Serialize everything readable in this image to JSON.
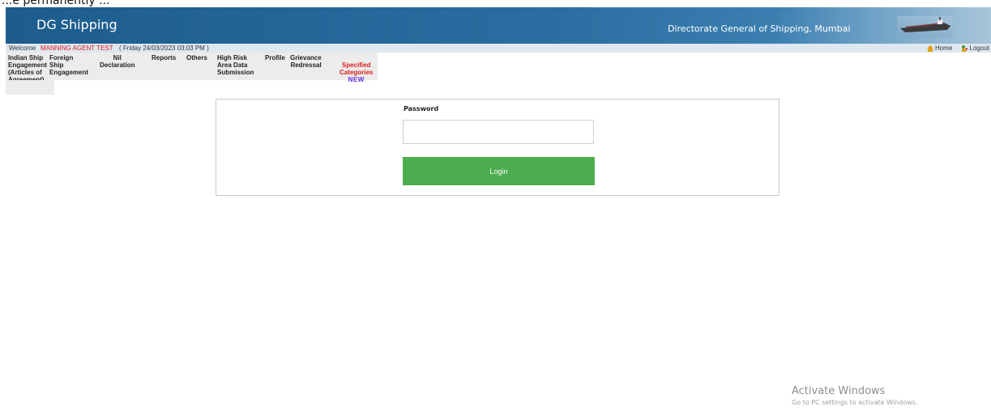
{
  "top_crop": {
    "text": "...e permanently ..."
  },
  "header": {
    "brand": "DG Shipping",
    "org": "Directorate General of Shipping, Mumbai",
    "ship_icon": "ship-icon",
    "background_color": "#2a6ea1"
  },
  "welcome_bar": {
    "welcome_label": "Welcome",
    "user_name": "MANNING AGENT TEST",
    "datetime": "( Friday 24/03/2023 03:03 PM )",
    "links": [
      {
        "label": "Home",
        "icon": "home-icon"
      },
      {
        "label": "Logout",
        "icon": "logout-icon"
      }
    ]
  },
  "menu": {
    "items": [
      {
        "label": "Indian Ship\nEngagement\n(Articles of\nAgreement)"
      },
      {
        "label": "Foreign\nShip\nEngagement"
      },
      {
        "label": "Nil\nDeclaration"
      },
      {
        "label": "Reports"
      },
      {
        "label": "Others"
      },
      {
        "label": "High Risk\nArea Data\nSubmission"
      },
      {
        "label": "Profile"
      },
      {
        "label": "Grievance\nRedressal"
      },
      {
        "label": "Specified\nCategories",
        "badge": "NEW",
        "color": "#e01b1b"
      }
    ]
  },
  "login": {
    "password_label": "Password",
    "password_value": "",
    "login_button": "Login",
    "button_color": "#4cad4f"
  },
  "watermark": {
    "title": "Activate Windows",
    "subtitle": "Go to PC settings to activate Windows."
  }
}
